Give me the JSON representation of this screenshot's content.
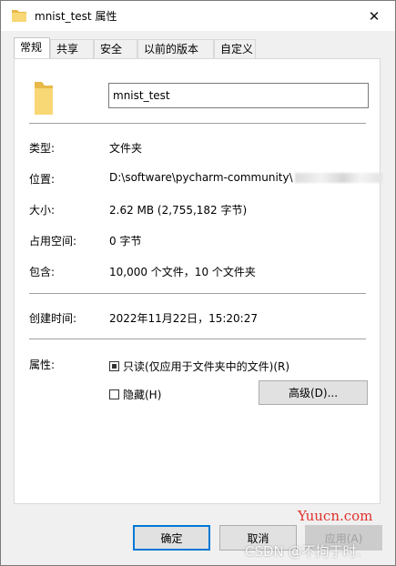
{
  "window": {
    "title": "mnist_test 属性",
    "close_glyph": "✕"
  },
  "tabs": [
    {
      "label": "常规",
      "active": true
    },
    {
      "label": "共享"
    },
    {
      "label": "安全"
    },
    {
      "label": "以前的版本"
    },
    {
      "label": "自定义"
    }
  ],
  "general": {
    "name_value": "mnist_test",
    "type": {
      "label": "类型:",
      "value": "文件夹"
    },
    "location": {
      "label": "位置:",
      "value": "D:\\software\\pycharm-community\\"
    },
    "size": {
      "label": "大小:",
      "value": "2.62 MB (2,755,182 字节)"
    },
    "size_on_disk": {
      "label": "占用空间:",
      "value": "0 字节"
    },
    "contains": {
      "label": "包含:",
      "value": "10,000 个文件，10 个文件夹"
    },
    "created": {
      "label": "创建时间:",
      "value": "2022年11月22日，15:20:27"
    },
    "attributes": {
      "label": "属性:",
      "readonly_label": "只读(仅应用于文件夹中的文件)(R)",
      "hidden_label": "隐藏(H)",
      "advanced_label": "高级(D)..."
    }
  },
  "buttons": {
    "ok": "确定",
    "cancel": "取消",
    "apply": "应用(A)"
  },
  "watermarks": {
    "site": "Yuucn.com",
    "csdn": "CSDN @不拘于时."
  },
  "colors": {
    "folder": "#f8d775",
    "folder_dark": "#e8b949",
    "primary_border": "#0078d7",
    "watermark_red": "#e0312b"
  }
}
